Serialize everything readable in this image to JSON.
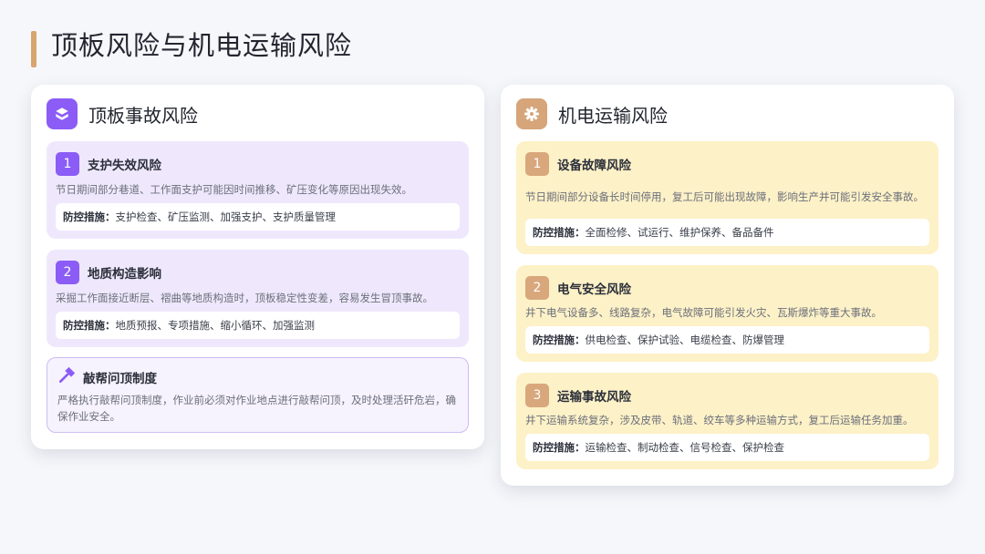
{
  "page": {
    "title": "顶板风险与机电运输风险"
  },
  "left": {
    "title": "顶板事故风险",
    "icon": "layers-icon",
    "cards": [
      {
        "num": "1",
        "title": "支护失效风险",
        "desc": "节日期间部分巷道、工作面支护可能因时间推移、矿压变化等原因出现失效。",
        "measure_label": "防控措施：",
        "measure": "支护检查、矿压监测、加强支护、支护质量管理"
      },
      {
        "num": "2",
        "title": "地质构造影响",
        "desc": "采掘工作面接近断层、褶曲等地质构造时，顶板稳定性变差，容易发生冒顶事故。",
        "measure_label": "防控措施：",
        "measure": "地质预报、专项措施、缩小循环、加强监测"
      }
    ],
    "notice": {
      "icon": "hammer-icon",
      "title": "敲帮问顶制度",
      "desc": "严格执行敲帮问顶制度，作业前必须对作业地点进行敲帮问顶，及时处理活矸危岩，确保作业安全。"
    }
  },
  "right": {
    "title": "机电运输风险",
    "icon": "gear-icon",
    "cards": [
      {
        "num": "1",
        "title": "设备故障风险",
        "desc": "节日期间部分设备长时间停用，复工后可能出现故障，影响生产并可能引发安全事故。",
        "measure_label": "防控措施：",
        "measure": "全面检修、试运行、维护保养、备品备件"
      },
      {
        "num": "2",
        "title": "电气安全风险",
        "desc": "井下电气设备多、线路复杂，电气故障可能引发火灾、瓦斯爆炸等重大事故。",
        "measure_label": "防控措施：",
        "measure": "供电检查、保护试验、电缆检查、防爆管理"
      },
      {
        "num": "3",
        "title": "运输事故风险",
        "desc": "井下运输系统复杂，涉及皮带、轨道、绞车等多种运输方式，复工后运输任务加重。",
        "measure_label": "防控措施：",
        "measure": "运输检查、制动检查、信号检查、保护检查"
      }
    ]
  },
  "colors": {
    "accent_bar": "#d9a56e",
    "purple": "#8b5cf6",
    "tan": "#d6a57a",
    "purple_card": "#efe8fd",
    "yellow_card": "#fdf1c7"
  }
}
